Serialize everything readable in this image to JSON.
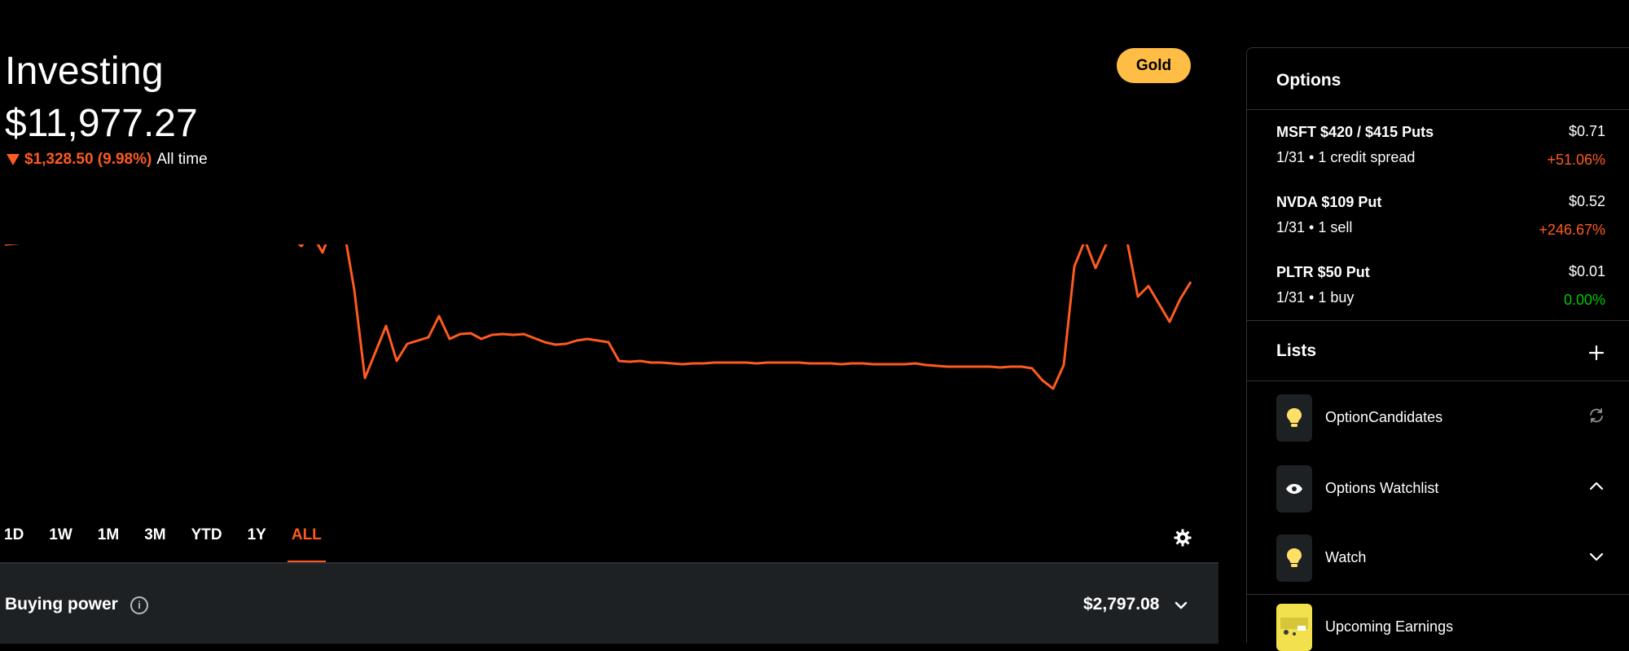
{
  "header": {
    "title": "Investing",
    "balance": "$11,977.27",
    "change": "$1,328.50 (9.98%)",
    "change_period": "All time",
    "gold_label": "Gold"
  },
  "colors": {
    "accent": "#ff5a1f",
    "gold": "#ffbd45",
    "positive": "#00c805",
    "panel": "#1e2124"
  },
  "chart_data": {
    "type": "line",
    "series": [
      {
        "values": [
          300,
          299,
          298,
          298,
          296,
          293,
          291,
          289,
          286,
          283,
          279,
          284,
          282,
          283,
          284,
          275,
          282,
          288,
          285,
          290,
          290,
          286,
          281,
          283,
          270,
          285,
          276,
          290,
          302,
          287,
          310,
          276,
          280,
          356,
          464,
          432,
          400,
          443,
          422,
          418,
          414,
          388,
          416,
          410,
          409,
          416,
          411,
          410,
          411,
          410,
          415,
          420,
          423,
          422,
          418,
          416,
          418,
          420,
          443,
          444,
          443,
          445,
          445,
          446,
          447,
          446,
          446,
          445,
          445,
          445,
          445,
          446,
          445,
          445,
          445,
          445,
          446,
          446,
          446,
          447,
          446,
          446,
          447,
          447,
          447,
          447,
          446,
          448,
          449,
          450,
          450,
          450,
          450,
          450,
          451,
          450,
          450,
          452,
          467,
          477,
          448,
          327,
          295,
          329,
          300,
          255,
          297,
          364,
          351,
          373,
          395,
          367,
          346
        ]
      }
    ],
    "note": "values are pixel-space estimates of the line path (lower = higher portfolio value); axis values not printed"
  },
  "range_tabs": [
    {
      "label": "1D",
      "active": false
    },
    {
      "label": "1W",
      "active": false
    },
    {
      "label": "1M",
      "active": false
    },
    {
      "label": "3M",
      "active": false
    },
    {
      "label": "YTD",
      "active": false
    },
    {
      "label": "1Y",
      "active": false
    },
    {
      "label": "ALL",
      "active": true
    }
  ],
  "settings_icon": "gear-icon",
  "buying_power": {
    "label": "Buying power",
    "info_glyph": "i",
    "value": "$2,797.08"
  },
  "sidebar": {
    "options_title": "Options",
    "options": [
      {
        "name": "MSFT $420 / $415 Puts",
        "sub": "1/31 • 1 credit spread",
        "price": "$0.71",
        "change": "+51.06%",
        "change_color": "orange"
      },
      {
        "name": "NVDA $109 Put",
        "sub": "1/31 • 1 sell",
        "price": "$0.52",
        "change": "+246.67%",
        "change_color": "orange"
      },
      {
        "name": "PLTR $50 Put",
        "sub": "1/31 • 1 buy",
        "price": "$0.01",
        "change": "0.00%",
        "change_color": "green"
      }
    ],
    "lists_title": "Lists",
    "lists": [
      {
        "label": "OptionCandidates",
        "icon": "lightbulb-icon",
        "action": "refresh-icon"
      },
      {
        "label": "Options Watchlist",
        "icon": "eye-icon",
        "action": "chevron-up-icon"
      },
      {
        "label": "Watch",
        "icon": "lightbulb-icon",
        "action": "chevron-down-icon"
      },
      {
        "label": "Upcoming Earnings",
        "icon": "calendar-icon",
        "action": ""
      }
    ]
  }
}
